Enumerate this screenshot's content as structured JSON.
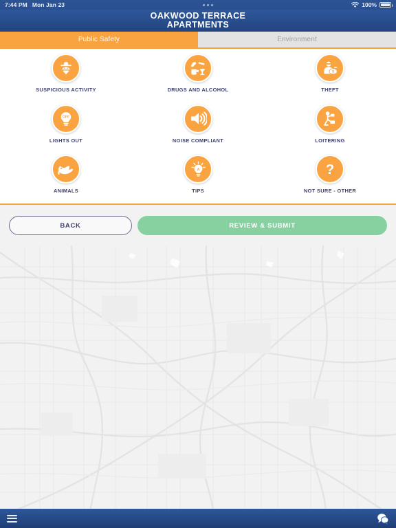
{
  "status_bar": {
    "time": "7:44 PM",
    "date": "Mon Jan 23",
    "battery_percent": "100%",
    "wifi_icon": "wifi-icon",
    "battery_icon": "battery-icon",
    "multitask_icon": "multitask-dots-icon"
  },
  "header": {
    "title_line1": "OAKWOOD TERRACE",
    "title_line2": "APARTMENTS"
  },
  "tabs": [
    {
      "label": "Public Safety",
      "active": true
    },
    {
      "label": "Environment",
      "active": false
    }
  ],
  "categories": [
    {
      "label": "SUSPICIOUS ACTIVITY",
      "icon": "detective-icon"
    },
    {
      "label": "DRUGS AND ALCOHOL",
      "icon": "drugs-alcohol-icon"
    },
    {
      "label": "THEFT",
      "icon": "burglar-moneybag-icon"
    },
    {
      "label": "LIGHTS OUT",
      "icon": "lightbulb-off-icon"
    },
    {
      "label": "NOISE COMPLIANT",
      "icon": "speaker-sound-icon"
    },
    {
      "label": "LOITERING",
      "icon": "person-sitting-icon"
    },
    {
      "label": "ANIMALS",
      "icon": "animal-icon"
    },
    {
      "label": "TIPS",
      "icon": "lightbulb-idea-icon"
    },
    {
      "label": "NOT SURE - OTHER",
      "icon": "question-mark-icon"
    }
  ],
  "actions": {
    "back_label": "BACK",
    "submit_label": "REVIEW & SUBMIT"
  },
  "bottom_bar": {
    "menu_icon": "hamburger-menu-icon",
    "chat_icon": "chat-bubble-icon"
  },
  "colors": {
    "header_blue": "#2e579a",
    "header_blue_dark": "#1f3d75",
    "accent_orange": "#f9a440",
    "tab_inactive_gray": "#e3e3e3",
    "submit_green": "#87d1a1",
    "label_navy": "#3d3f6b",
    "map_bg": "#f2f2f2"
  }
}
